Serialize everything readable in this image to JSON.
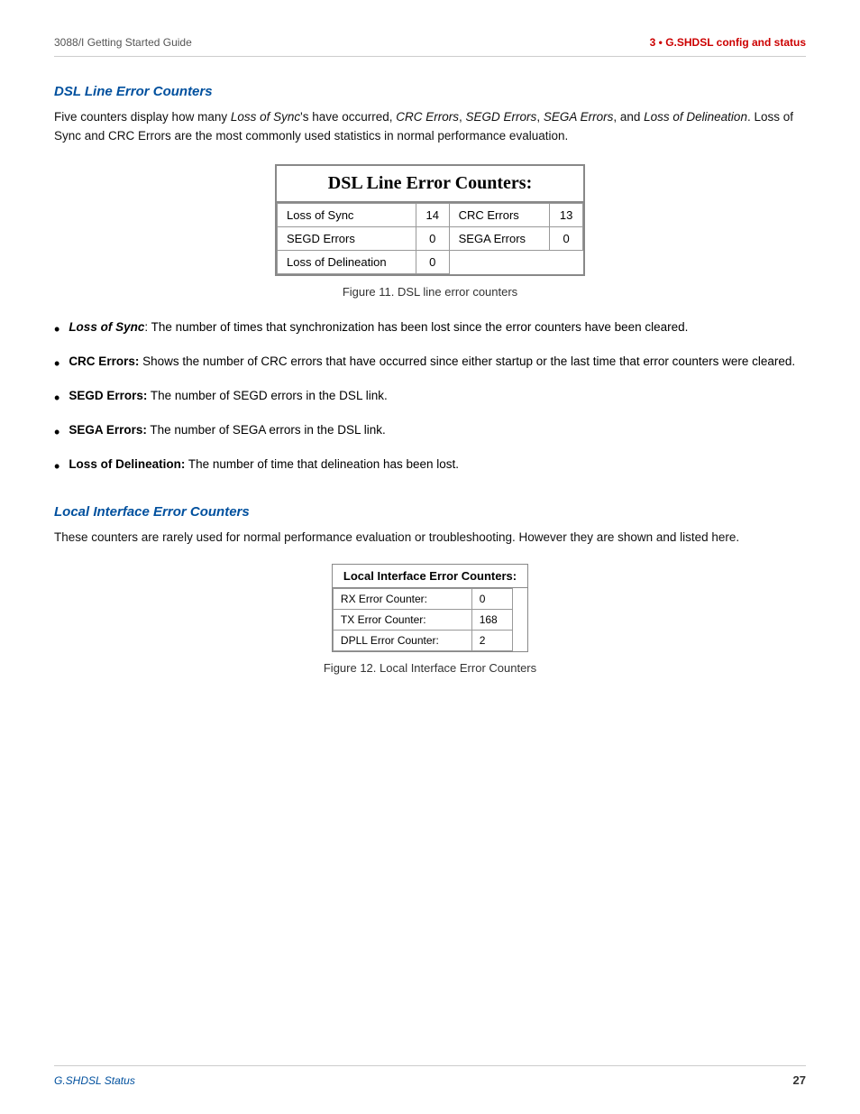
{
  "header": {
    "left": "3088/I Getting Started Guide",
    "right": "3 • G.SHDSL config and status"
  },
  "dsl_section": {
    "heading": "DSL Line Error Counters",
    "intro": "Five counters display how many Loss of Sync's have occurred, CRC Errors, SEGD Errors, SEGA Errors, and Loss of Delineation. Loss of Sync and CRC Errors are the most commonly used statistics in normal performance evaluation.",
    "table_title": "DSL Line Error Counters:",
    "table_rows": [
      {
        "col1_label": "Loss of Sync",
        "col1_val": "14",
        "col2_label": "CRC Errors",
        "col2_val": "13"
      },
      {
        "col1_label": "SEGD Errors",
        "col1_val": "0",
        "col2_label": "SEGA Errors",
        "col2_val": "0"
      },
      {
        "col1_label": "Loss of Delineation",
        "col1_val": "0",
        "col2_label": "",
        "col2_val": ""
      }
    ],
    "figure_caption": "Figure 11. DSL line error counters",
    "bullets": [
      {
        "term": "Loss of Sync",
        "term_type": "bold-italic",
        "text": ": The number of times that synchronization has been lost since the error counters have been cleared."
      },
      {
        "term": "CRC Errors:",
        "term_type": "bold",
        "text": " Shows the number of CRC errors that have occurred since either startup or the last time that error counters were cleared."
      },
      {
        "term": "SEGD Errors:",
        "term_type": "bold",
        "text": " The number of SEGD errors in the DSL link."
      },
      {
        "term": "SEGA Errors:",
        "term_type": "bold",
        "text": " The number of SEGA errors in the DSL link."
      },
      {
        "term": "Loss of Delineation:",
        "term_type": "bold",
        "text": " The number of time that delineation has been lost."
      }
    ]
  },
  "local_section": {
    "heading": "Local Interface Error Counters",
    "intro": "These counters are rarely used for normal performance evaluation or troubleshooting. However they are shown and listed here.",
    "table_title": "Local Interface Error Counters:",
    "table_rows": [
      {
        "label": "RX Error Counter:",
        "value": "0"
      },
      {
        "label": "TX Error Counter:",
        "value": "168"
      },
      {
        "label": "DPLL Error Counter:",
        "value": "2"
      }
    ],
    "figure_caption": "Figure 12. Local Interface Error Counters"
  },
  "footer": {
    "left": "G.SHDSL Status",
    "right": "27"
  }
}
